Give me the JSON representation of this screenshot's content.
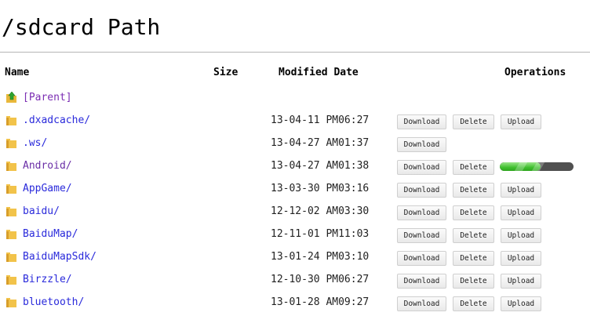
{
  "page": {
    "title": "/sdcard Path"
  },
  "table": {
    "headers": {
      "name": "Name",
      "size": "Size",
      "modified": "Modified Date",
      "operations": "Operations"
    },
    "parent_label": "[Parent]",
    "rows": [
      {
        "name": ".dxadcache/",
        "modified": "13-04-11 PM06:27",
        "download": "Download",
        "delete": "Delete",
        "upload": "Upload"
      },
      {
        "name": ".ws/",
        "modified": "13-04-27 AM01:37",
        "download": "Download"
      },
      {
        "name": "Android/",
        "modified": "13-04-27 AM01:38",
        "download": "Download",
        "delete": "Delete",
        "upload_progress": 0.55
      },
      {
        "name": "AppGame/",
        "modified": "13-03-30 PM03:16",
        "download": "Download",
        "delete": "Delete",
        "upload": "Upload"
      },
      {
        "name": "baidu/",
        "modified": "12-12-02 AM03:30",
        "download": "Download",
        "delete": "Delete",
        "upload": "Upload"
      },
      {
        "name": "BaiduMap/",
        "modified": "12-11-01 PM11:03",
        "download": "Download",
        "delete": "Delete",
        "upload": "Upload"
      },
      {
        "name": "BaiduMapSdk/",
        "modified": "13-01-24 PM03:10",
        "download": "Download",
        "delete": "Delete",
        "upload": "Upload"
      },
      {
        "name": "Birzzle/",
        "modified": "12-10-30 PM06:27",
        "download": "Download",
        "delete": "Delete",
        "upload": "Upload"
      },
      {
        "name": "bluetooth/",
        "modified": "13-01-28 AM09:27",
        "download": "Download",
        "delete": "Delete",
        "upload": "Upload"
      }
    ]
  },
  "colors": {
    "link": "#2a2adb",
    "visited_link": "#6a2ea6",
    "progress_fill": "#3fbf2e",
    "progress_track": "#505050",
    "folder": "#f2c34a"
  },
  "icons": {
    "folder": "folder-icon",
    "parent": "parent-folder-icon"
  }
}
